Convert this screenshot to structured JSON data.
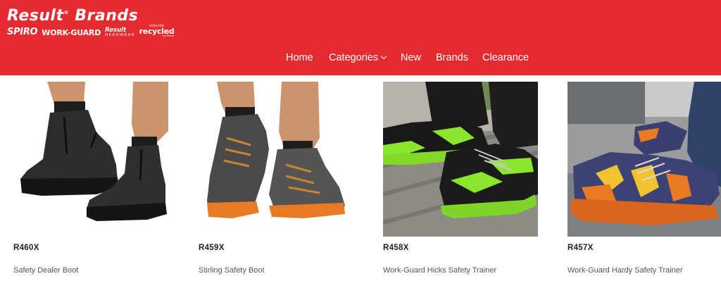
{
  "logo": {
    "main": "Result",
    "registered": "®",
    "main2": "Brands",
    "sub_brands": {
      "spiro": "SPIRO",
      "workguard": "WORK-GUARD",
      "result_headwear_a": "Result",
      "result_headwear_b": "HEADWEAR",
      "recycled_a": "GENUINE",
      "recycled_b": "recycled",
      "recycled_c": "by Result"
    }
  },
  "nav": {
    "home": "Home",
    "categories": "Categories",
    "new": "New",
    "brands": "Brands",
    "clearance": "Clearance"
  },
  "products": [
    {
      "sku": "R460X",
      "name": "Safety Dealer Boot"
    },
    {
      "sku": "R459X",
      "name": "Stirling Safety Boot"
    },
    {
      "sku": "R458X",
      "name": "Work-Guard Hicks Safety Trainer"
    },
    {
      "sku": "R457X",
      "name": "Work-Guard Hardy Safety Trainer"
    }
  ],
  "colors": {
    "header_bg": "#e52b2f",
    "nav_text": "#ffffff"
  },
  "icons": {
    "categories_dropdown": "chevron-down-icon"
  }
}
